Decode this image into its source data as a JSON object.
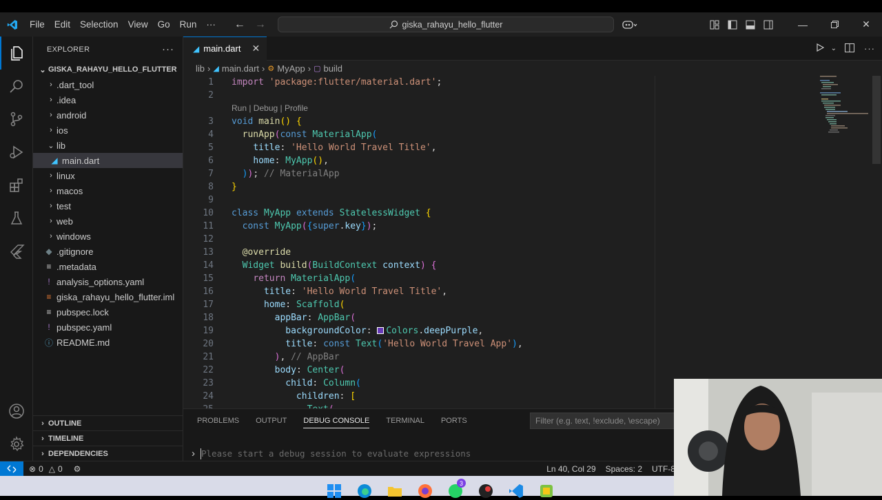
{
  "app": {
    "search_text": "giska_rahayu_hello_flutter",
    "menu": [
      "File",
      "Edit",
      "Selection",
      "View",
      "Go",
      "Run",
      "···"
    ]
  },
  "explorer": {
    "title": "EXPLORER",
    "root": "GISKA_RAHAYU_HELLO_FLUTTER",
    "items": [
      {
        "label": ".dart_tool",
        "kind": "folder",
        "depth": 0,
        "open": false
      },
      {
        "label": ".idea",
        "kind": "folder",
        "depth": 0,
        "open": false
      },
      {
        "label": "android",
        "kind": "folder",
        "depth": 0,
        "open": false
      },
      {
        "label": "ios",
        "kind": "folder",
        "depth": 0,
        "open": false
      },
      {
        "label": "lib",
        "kind": "folder",
        "depth": 0,
        "open": true
      },
      {
        "label": "main.dart",
        "kind": "dart",
        "depth": 1,
        "selected": true
      },
      {
        "label": "linux",
        "kind": "folder",
        "depth": 0,
        "open": false
      },
      {
        "label": "macos",
        "kind": "folder",
        "depth": 0,
        "open": false
      },
      {
        "label": "test",
        "kind": "folder",
        "depth": 0,
        "open": false
      },
      {
        "label": "web",
        "kind": "folder",
        "depth": 0,
        "open": false
      },
      {
        "label": "windows",
        "kind": "folder",
        "depth": 0,
        "open": false
      },
      {
        "label": ".gitignore",
        "kind": "git",
        "depth": 0
      },
      {
        "label": ".metadata",
        "kind": "text",
        "depth": 0
      },
      {
        "label": "analysis_options.yaml",
        "kind": "yaml",
        "depth": 0
      },
      {
        "label": "giska_rahayu_hello_flutter.iml",
        "kind": "xml",
        "depth": 0
      },
      {
        "label": "pubspec.lock",
        "kind": "text",
        "depth": 0
      },
      {
        "label": "pubspec.yaml",
        "kind": "yaml",
        "depth": 0
      },
      {
        "label": "README.md",
        "kind": "info",
        "depth": 0
      }
    ],
    "sections": [
      "OUTLINE",
      "TIMELINE",
      "DEPENDENCIES"
    ]
  },
  "editor": {
    "tab_label": "main.dart",
    "breadcrumb": [
      "lib",
      "main.dart",
      "MyApp",
      "build"
    ],
    "codelens": "Run | Debug | Profile"
  },
  "panel": {
    "tabs": [
      "PROBLEMS",
      "OUTPUT",
      "DEBUG CONSOLE",
      "TERMINAL",
      "PORTS"
    ],
    "active_tab": "DEBUG CONSOLE",
    "filter_placeholder": "Filter (e.g. text, !exclude, \\escape)",
    "repl_placeholder": "Please start a debug session to evaluate expressions"
  },
  "status": {
    "errors": "0",
    "warnings": "0",
    "position": "Ln 40, Col 29",
    "spaces": "Spaces: 2",
    "encoding": "UTF-8"
  },
  "taskbar": {
    "whatsapp_badge": "3"
  },
  "colors": {
    "accent": "#0078d4",
    "editor_bg": "#1f1f1f",
    "sidebar_bg": "#181818",
    "swatch": "#673ab7"
  }
}
